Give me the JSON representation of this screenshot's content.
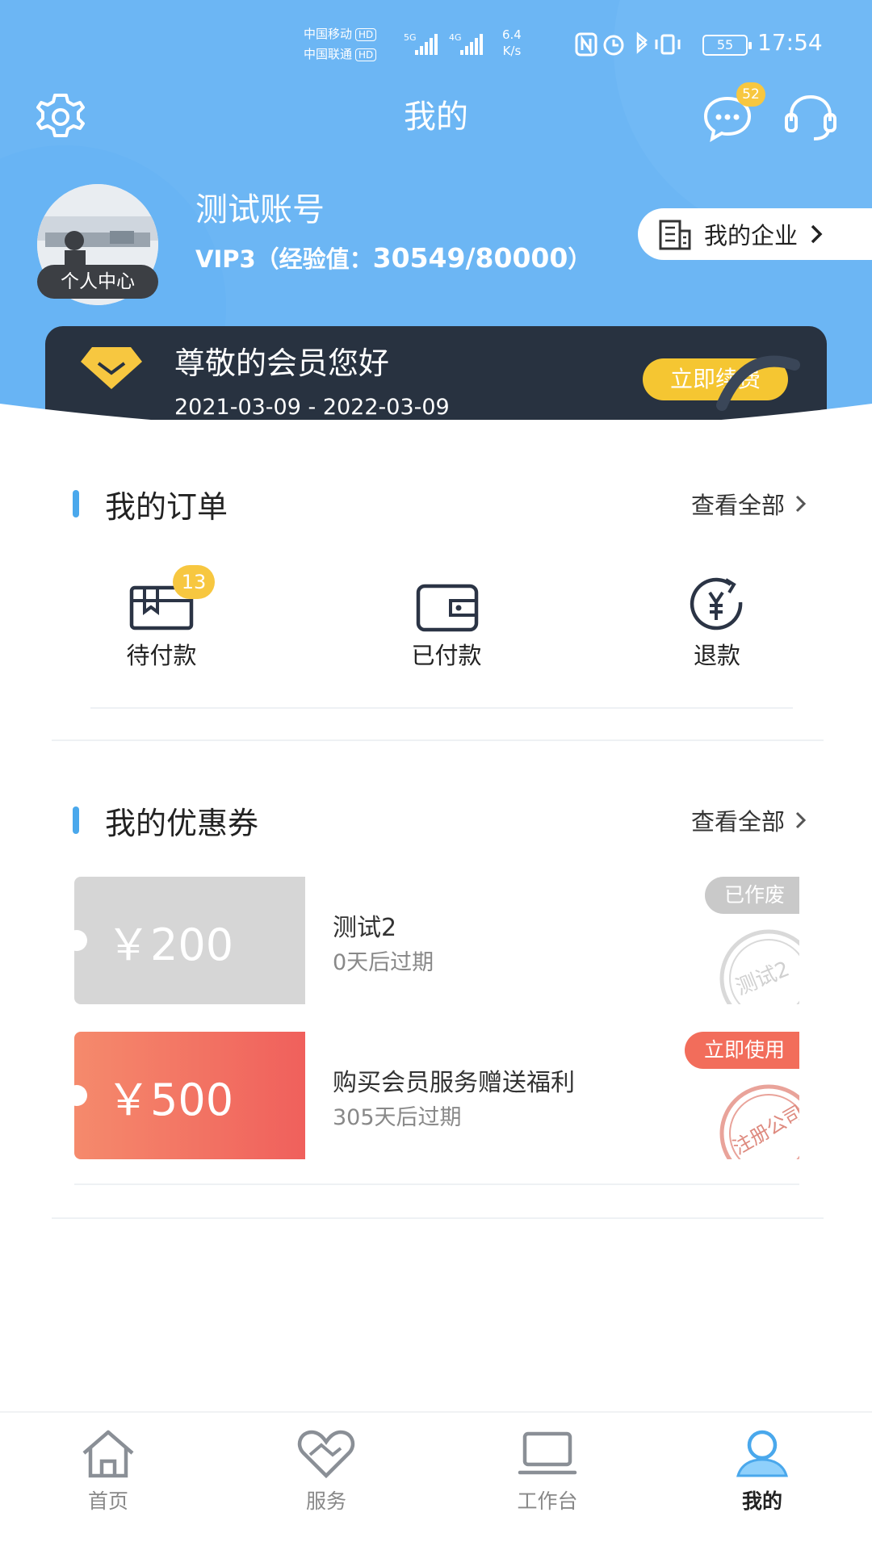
{
  "status_bar": {
    "carrier_1": "中国移动",
    "carrier_2": "中国联通",
    "hd_label": "HD",
    "signal_1": "5G",
    "signal_2": "4G",
    "speed_value": "6.4",
    "speed_unit": "K/s",
    "battery": "55",
    "time": "17:54"
  },
  "header": {
    "title": "我的",
    "message_badge": "52"
  },
  "profile": {
    "avatar_label": "个人中心",
    "username": "测试账号",
    "vip_level": "VIP3（经验值：",
    "experience": "30549/80000",
    "vip_suffix": "）",
    "enterprise_label": "我的企业"
  },
  "vip_card": {
    "greeting": "尊敬的会员您好",
    "dates": "2021-03-09 - 2022-03-09",
    "renew_label": "立即续费"
  },
  "orders": {
    "title": "我的订单",
    "view_all": "查看全部",
    "items": [
      {
        "label": "待付款",
        "icon": "pending-payment-icon",
        "badge": "13"
      },
      {
        "label": "已付款",
        "icon": "wallet-icon"
      },
      {
        "label": "退款",
        "icon": "refund-icon"
      }
    ]
  },
  "coupons": {
    "title": "我的优惠券",
    "view_all": "查看全部",
    "items": [
      {
        "amount": "￥200",
        "name": "测试2",
        "expiry": "0天后过期",
        "tag": "已作废",
        "stamp_text": "测试2",
        "color": "#d6d6d6",
        "tag_color": "#c9c9c9"
      },
      {
        "amount": "￥500",
        "name": "购买会员服务赠送福利",
        "expiry": "305天后过期",
        "tag": "立即使用",
        "stamp_text": "注册公司",
        "color": "#f5735f",
        "tag_color": "#f26d5b"
      }
    ]
  },
  "tabbar": {
    "items": [
      {
        "label": "首页",
        "icon": "home-icon"
      },
      {
        "label": "服务",
        "icon": "service-heart-icon"
      },
      {
        "label": "工作台",
        "icon": "workbench-icon"
      },
      {
        "label": "我的",
        "icon": "profile-icon",
        "active": true
      }
    ]
  },
  "colors": {
    "header_blue": "#6cb6f4",
    "accent_blue": "#4aa8ec",
    "badge_yellow": "#f7c740",
    "vip_card_dark": "#283240",
    "renew_yellow": "#f5c632"
  }
}
